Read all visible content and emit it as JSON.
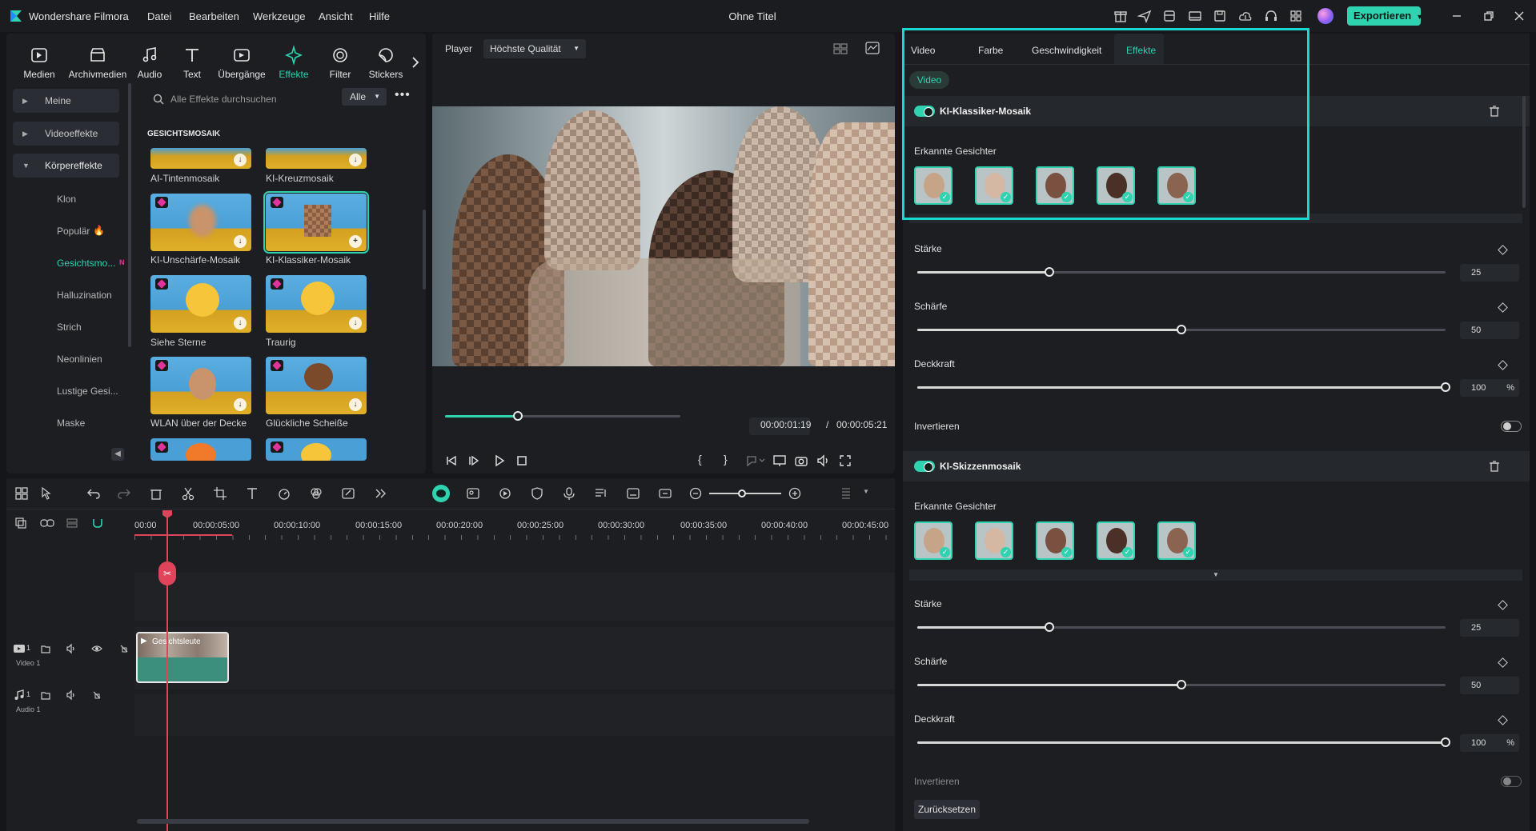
{
  "app": {
    "name": "Wondershare Filmora",
    "window_title": "Ohne Titel",
    "menus": [
      "Datei",
      "Bearbeiten",
      "Werkzeuge",
      "Ansicht",
      "Hilfe"
    ],
    "export_label": "Exportieren",
    "accent": "#2fd3b0"
  },
  "media_tabs": [
    "Medien",
    "Archivmedien",
    "Audio",
    "Text",
    "Übergänge",
    "Effekte",
    "Filter",
    "Stickers"
  ],
  "sidebar": {
    "categories": [
      "Meine",
      "Videoeffekte",
      "Körpereffekte"
    ],
    "subitems": [
      "Klon",
      "Populär",
      "Gesichtsmo...",
      "Halluzination",
      "Strich",
      "Neonlinien",
      "Lustige Gesi...",
      "Maske"
    ]
  },
  "search": {
    "placeholder": "Alle Effekte durchsuchen",
    "filter": "Alle"
  },
  "effects_group": "GESICHTSMOSAIK",
  "effects": [
    {
      "label": "AI-Tintenmosaik"
    },
    {
      "label": "KI-Kreuzmosaik"
    },
    {
      "label": "KI-Unschärfe-Mosaik"
    },
    {
      "label": "KI-Klassiker-Mosaik"
    },
    {
      "label": "Siehe Sterne"
    },
    {
      "label": "Traurig"
    },
    {
      "label": "WLAN über der Decke"
    },
    {
      "label": "Glückliche Scheiße"
    }
  ],
  "player": {
    "label": "Player",
    "quality": "Höchste Qualität",
    "current_time": "00:00:01:19",
    "separator": "/",
    "total_time": "00:00:05:21",
    "progress": 0.31
  },
  "props": {
    "tabs": [
      "Video",
      "Farbe",
      "Geschwindigkeit",
      "Effekte"
    ],
    "subtab": "Video",
    "effect1": {
      "name": "KI-Klassiker-Mosaik",
      "faces_label": "Erkannte Gesichter",
      "params": [
        {
          "label": "Stärke",
          "value": "25",
          "level": 0.25,
          "unit": ""
        },
        {
          "label": "Schärfe",
          "value": "50",
          "level": 0.5,
          "unit": ""
        },
        {
          "label": "Deckkraft",
          "value": "100",
          "level": 1.0,
          "unit": "%"
        }
      ],
      "invert_label": "Invertieren"
    },
    "effect2": {
      "name": "KI-Skizzenmosaik",
      "faces_label": "Erkannte Gesichter",
      "params": [
        {
          "label": "Stärke",
          "value": "25",
          "level": 0.25,
          "unit": ""
        },
        {
          "label": "Schärfe",
          "value": "50",
          "level": 0.5,
          "unit": ""
        },
        {
          "label": "Deckkraft",
          "value": "100",
          "level": 1.0,
          "unit": "%"
        }
      ],
      "invert_label": "Invertieren"
    },
    "reset_label": "Zurücksetzen"
  },
  "timeline": {
    "ruler": [
      "00:00",
      "00:00:05:00",
      "00:00:10:00",
      "00:00:15:00",
      "00:00:20:00",
      "00:00:25:00",
      "00:00:30:00",
      "00:00:35:00",
      "00:00:40:00",
      "00:00:45:00"
    ],
    "video_track_label": "Video 1",
    "audio_track_label": "Audio 1",
    "clip_title": "Gesichtsleute",
    "video_track_num": "1",
    "audio_track_num": "1"
  }
}
